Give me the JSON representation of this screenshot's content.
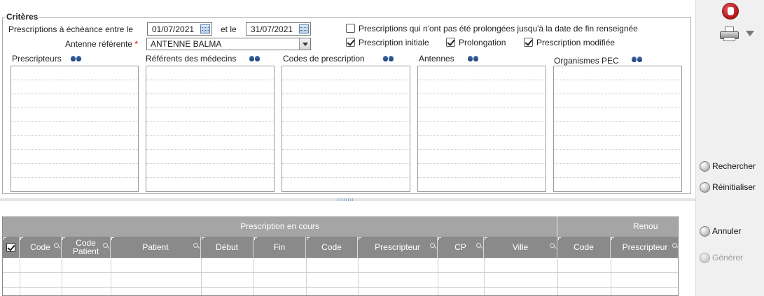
{
  "criteria": {
    "legend": "Critères",
    "echeance_label": "Prescriptions à échéance entre le",
    "date_from": "01/07/2021",
    "between_label": "et le",
    "date_to": "31/07/2021",
    "antenne_label": "Antenne référente",
    "required_mark": "*",
    "antenne_value": "ANTENNE BALMA",
    "not_prolonged_label": "Prescriptions qui n'ont pas été prolongées jusqu'à la date de fin renseignée",
    "not_prolonged_checked": false,
    "initiale_label": "Prescription initiale",
    "initiale_checked": true,
    "prolongation_label": "Prolongation",
    "prolongation_checked": true,
    "modifiee_label": "Prescription modifiée",
    "modifiee_checked": true
  },
  "lists": [
    {
      "title": "Prescripteurs",
      "icon": "binoculars-icon"
    },
    {
      "title": "Référents des médecins",
      "icon": "binoculars-icon"
    },
    {
      "title": "Codes de prescription",
      "icon": "binoculars-icon"
    },
    {
      "title": "Antennes",
      "icon": "binoculars-icon"
    },
    {
      "title": "Organismes PEC",
      "icon": "binoculars-icon"
    }
  ],
  "sidebar": {
    "stop_icon": "stop-hand-icon",
    "print_icon": "printer-icon",
    "rechercher": "Rechercher",
    "reinitialiser": "Réinitialiser",
    "annuler": "Annuler",
    "generer": "Générer"
  },
  "grid": {
    "group1": "Prescription en cours",
    "group2": "Renou",
    "columns": [
      "Code",
      "Code Patient",
      "Patient",
      "Début",
      "Fin",
      "Code",
      "Prescripteur",
      "CP",
      "Ville",
      "Code",
      "Prescripteur"
    ],
    "code_patient_line1": "Code",
    "code_patient_line2": "Patient"
  }
}
